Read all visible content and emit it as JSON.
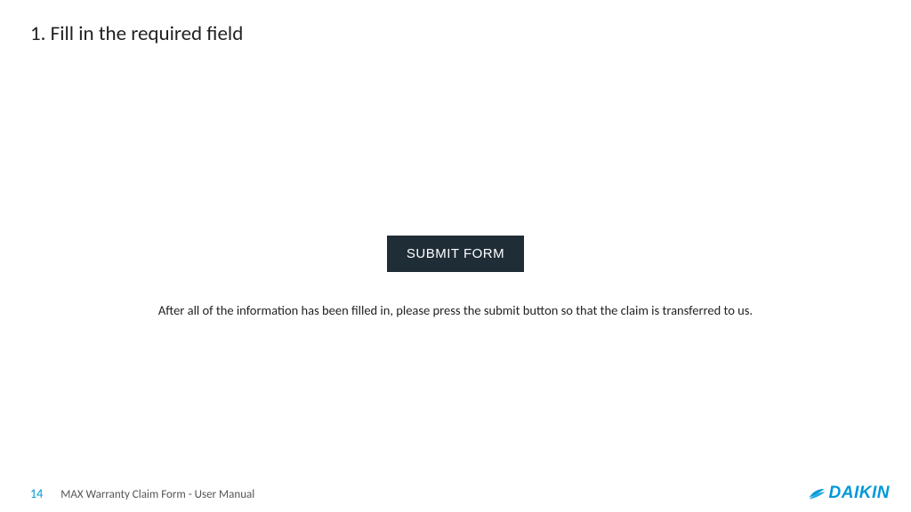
{
  "heading": "1. Fill in the required field",
  "button_label": "SUBMIT FORM",
  "instruction": "After all of the information has been filled in, please press the submit button so that the claim is transferred to us.",
  "footer": {
    "page_number": "14",
    "doc_title": "MAX Warranty Claim Form - User Manual"
  },
  "brand": {
    "name": "DAIKIN",
    "accent_color": "#0099d8"
  }
}
